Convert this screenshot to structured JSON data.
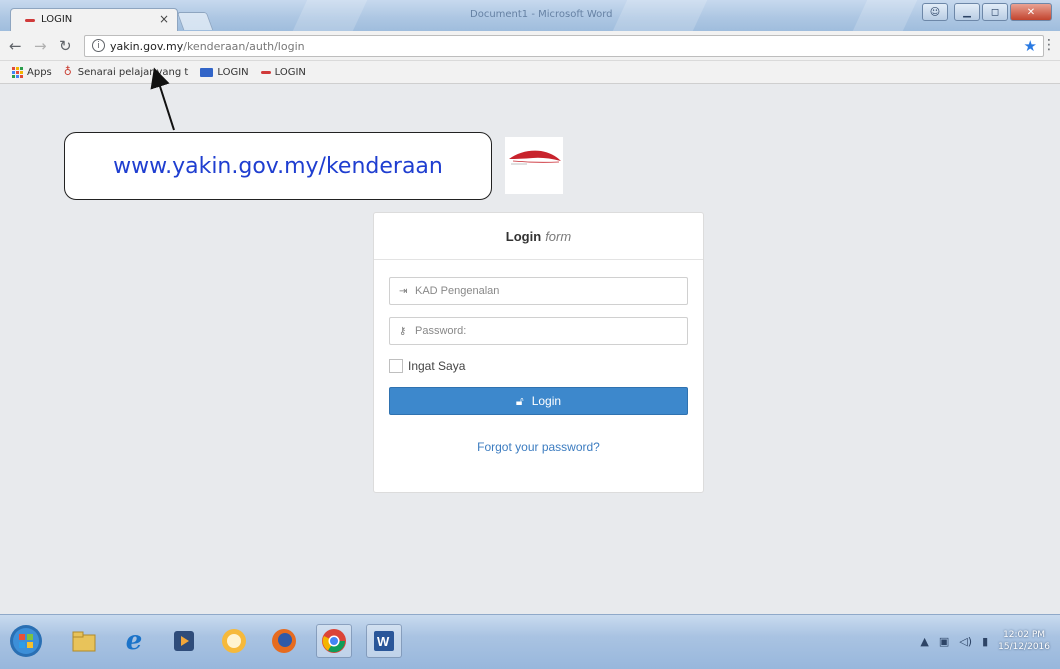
{
  "browser": {
    "window_title": "Document1 - Microsoft Word",
    "tab_title": "LOGIN",
    "tab_close": "×",
    "url_host": "yakin.gov.my",
    "url_path": "/kenderaan/auth/login",
    "bookmarks": [
      {
        "label": "Apps"
      },
      {
        "label": "Senarai pelajar yang t"
      },
      {
        "label": "LOGIN"
      },
      {
        "label": "LOGIN"
      }
    ]
  },
  "callout": {
    "text": "www.yakin.gov.my/kenderaan"
  },
  "login": {
    "title_bold": "Login",
    "title_italic": "form",
    "ic_placeholder": "KAD Pengenalan",
    "password_placeholder": "Password:",
    "remember_label": "Ingat Saya",
    "button_label": "Login",
    "forgot_link": "Forgot your password?"
  },
  "taskbar": {
    "items": [
      "start-orb",
      "explorer",
      "internet-explorer",
      "media-player",
      "messenger",
      "firefox",
      "chrome",
      "word"
    ],
    "active": "chrome",
    "clock_time": "12:02 PM",
    "clock_date": "15/12/2016"
  },
  "colors": {
    "accent": "#3d88cc",
    "callout_text": "#1f3ed0",
    "link": "#3c7cc0"
  }
}
